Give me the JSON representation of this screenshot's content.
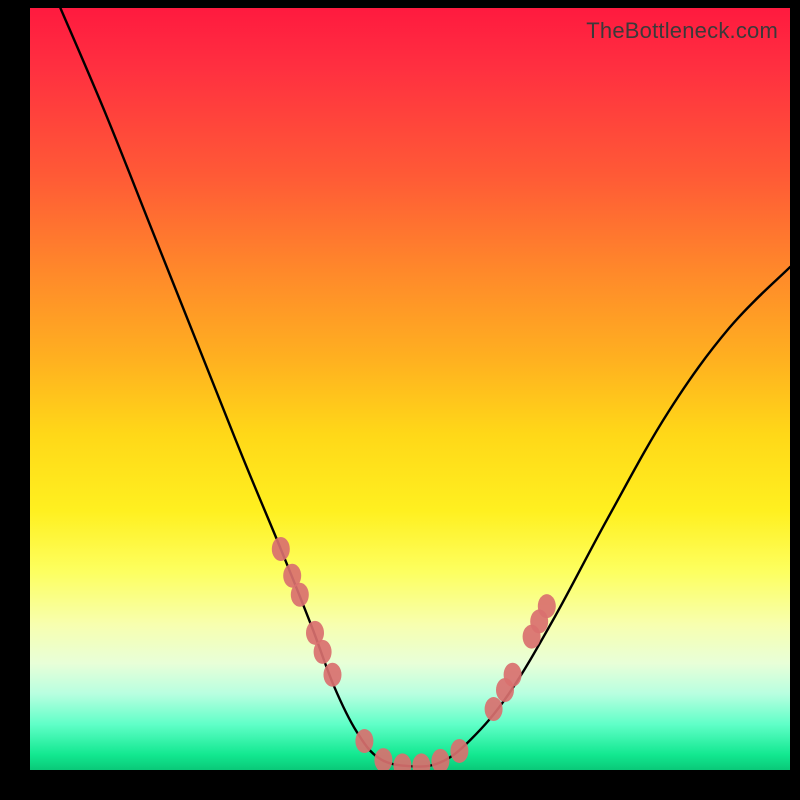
{
  "watermark": "TheBottleneck.com",
  "chart_data": {
    "type": "line",
    "title": "",
    "xlabel": "",
    "ylabel": "",
    "xlim": [
      0,
      100
    ],
    "ylim": [
      0,
      100
    ],
    "series": [
      {
        "name": "curve",
        "x": [
          4,
          10,
          16,
          22,
          28,
          33,
          37,
          40,
          43,
          46,
          50,
          54,
          58,
          63,
          69,
          76,
          84,
          92,
          100
        ],
        "values": [
          100,
          86,
          71,
          56,
          41,
          29,
          19,
          11,
          5,
          1.5,
          0.5,
          1,
          4,
          10,
          20,
          33,
          47,
          58,
          66
        ]
      }
    ],
    "markers": [
      {
        "name": "left-cluster",
        "points": [
          {
            "x": 33,
            "y": 29
          },
          {
            "x": 34.5,
            "y": 25.5
          },
          {
            "x": 35.5,
            "y": 23
          },
          {
            "x": 37.5,
            "y": 18
          },
          {
            "x": 38.5,
            "y": 15.5
          },
          {
            "x": 39.8,
            "y": 12.5
          }
        ]
      },
      {
        "name": "bottom-cluster",
        "points": [
          {
            "x": 44,
            "y": 3.8
          },
          {
            "x": 46.5,
            "y": 1.3
          },
          {
            "x": 49,
            "y": 0.6
          },
          {
            "x": 51.5,
            "y": 0.6
          },
          {
            "x": 54,
            "y": 1.2
          },
          {
            "x": 56.5,
            "y": 2.5
          }
        ]
      },
      {
        "name": "right-cluster",
        "points": [
          {
            "x": 61,
            "y": 8
          },
          {
            "x": 62.5,
            "y": 10.5
          },
          {
            "x": 63.5,
            "y": 12.5
          },
          {
            "x": 66,
            "y": 17.5
          },
          {
            "x": 67,
            "y": 19.5
          },
          {
            "x": 68,
            "y": 21.5
          }
        ]
      }
    ]
  }
}
